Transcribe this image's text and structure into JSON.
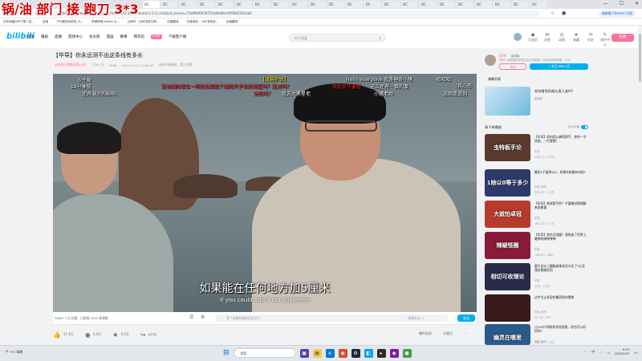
{
  "overlay": {
    "title": "锅/油 部门 接 跑刀 3*3"
  },
  "browser": {
    "tabs": [
      "DC",
      "DC",
      "DC",
      "DC",
      "DC",
      "DC",
      "DC",
      "DC",
      "DC",
      "DC",
      "DC",
      "DC",
      "DC",
      "DC",
      "DC",
      "DC",
      "DC",
      "DC",
      "DC",
      "DC",
      "DC",
      "DC"
    ],
    "address": "bilibili.com/video/BV1...?spm_id_from=333.1007.tianma.1-2-2.click&vd_source=74d09d6678725e9ba8ec9058b5202eb4",
    "chrome_button": "有新版 Chrome 可用",
    "bookmarks": [
      "文件网盘APP下载 | 百...",
      "百度",
      "下行服务系统查_代...",
      "哔哩哔哩_bilibili 大...",
      "比特币 · 比特币官方网...",
      "百度翻译",
      "抖音网站 - 小红书网站...",
      "百度翻译"
    ]
  },
  "site": {
    "logo": "bilibili",
    "nav": [
      "首页",
      "番剧",
      "直播",
      "游戏中心",
      "会员购",
      "漫画",
      "赛事",
      "拜年纪",
      "LIVE",
      "下载客户端"
    ],
    "search_placeholder": "你不知道",
    "header_icons": [
      {
        "glyph": "◆",
        "label": "大会员"
      },
      {
        "glyph": "✉",
        "label": "消息"
      },
      {
        "glyph": "◎",
        "label": "动态"
      },
      {
        "glyph": "★",
        "label": "收藏"
      },
      {
        "glyph": "⟲",
        "label": "历史"
      },
      {
        "glyph": "✎",
        "label": "创作中心"
      }
    ],
    "upload": "投稿"
  },
  "video": {
    "title": "【毕导】你永远测不出这条线有多长",
    "meta": {
      "tag": "全站排行榜最高第10名",
      "views": "136.1万",
      "danmaku": "5489",
      "date": "2024-02-11 11:00:00",
      "copyright": "未经作者授权，禁止转载"
    },
    "danmaku": [
      {
        "text": "沙子呢",
        "color": "#ffffff"
      },
      {
        "text": "18分钟前",
        "color": "#ffffff"
      },
      {
        "text": "还有潮汐的影响",
        "color": "#ffffff"
      },
      {
        "text": "没有国际单位一样的东西就个国际尺子长的测定吗？这对吗？",
        "color": "#ff2a2a"
      },
      {
        "text": "分形吗？",
        "color": "#ff2a2a"
      },
      {
        "text": "【弹幕护体】",
        "color": "#ffe600"
      },
      {
        "text": "我去大黑星老",
        "color": "#ffffff"
      },
      {
        "text": "我就是不要看",
        "color": "#ff2a2a"
      },
      {
        "text": "Hello everyone 我是神奇小猪",
        "color": "#ffffff"
      },
      {
        "text": "这么还有一数的事",
        "color": "#ffffff"
      },
      {
        "text": "小猪老师",
        "color": "#ffffff"
      },
      {
        "text": "哈哈哈",
        "color": "#ffffff"
      },
      {
        "text": "（我心态",
        "color": "#ffffff"
      },
      {
        "text": "这倒是提到",
        "color": "#ffffff"
      }
    ],
    "subtitle_cn": "如果能在任何地方加5厘米",
    "subtitle_en": "If you could add 5 cm anywhere",
    "danmaku_bar": {
      "count": "3088+人正在看，已装填 5000 条弹幕",
      "placeholder": "发个友善的弹幕见证当下",
      "send": "发送",
      "etiquette": "弹幕礼仪 >"
    },
    "actions": [
      {
        "glyph": "👍",
        "value": "11.6万"
      },
      {
        "glyph": "◉",
        "value": "5.4万"
      },
      {
        "glyph": "★",
        "value": "3.0万"
      },
      {
        "glyph": "↪",
        "value": "4779"
      }
    ],
    "actions_right": [
      "稿件投诉",
      "记笔记",
      "⋯"
    ]
  },
  "sidebar": {
    "up_name": "毕导",
    "up_badge": "发消息",
    "up_desc": "科研一线颓废科学博主的日常更新，比起科研更有趣！TUP...",
    "charge": "充电",
    "follow": "+ 关注 986.5万",
    "danmaku_list": "弹幕列表",
    "ad": {
      "title": "如何看到风格从真人变AI?",
      "sub": "剧版拍"
    },
    "next_label": "接下来播放",
    "autoplay": "自动连播",
    "recs": [
      {
        "thumb": "虫特板手论",
        "title": "【毕导】如何用心搞得两手，你你一字语录，一打就就!",
        "up": "毕导",
        "stats": "336.4万 · 2.3万",
        "bg": "#5a3a2c"
      },
      {
        "thumb": "1除以0等于多少",
        "title": "最初1千旋除以0，如果风神要有何说?",
        "up": "毕导_科学",
        "stats": "297.9万 · 1.2万",
        "bg": "#2c3a6a"
      },
      {
        "thumb": "大就怕卓冠",
        "title": "【毕导】地球是平的？不要硬讲我理解来说能懂",
        "up": "毕导",
        "stats": "102.1万 · 1.7万",
        "bg": "#b83a2a"
      },
      {
        "thumb": "辣椒怪圈",
        "title": "【毕导】改东北怪圈？我找来了世界上最弹的弹弹弹弹",
        "up": "毕导",
        "stats": "786.6万 · 6681",
        "bg": "#8a1a3a"
      },
      {
        "thumb": "相切可收理论",
        "title": "要片设计上翻脑部来说怎么吃了?以及我好能够应用",
        "up": "毕导",
        "stats": "45万 · 8.4万",
        "bg": "#2a2a4a"
      },
      {
        "thumb": "",
        "title": "边今为止发现的最奇怪的素数",
        "up": "毕导_科学",
        "stats": "44.7万 · 293",
        "bg": "#3a1a1a"
      },
      {
        "thumb": "幽灵在哪里",
        "title": "让100只鸡和你发现惊喜，你也可以好好的?",
        "up": "毕导_科学",
        "stats": "980.2万 · 1.4万",
        "bg": "#2a5a8a"
      }
    ]
  },
  "taskbar": {
    "weather_temp": "5°C",
    "weather_desc": "晴朗",
    "search_placeholder": "搜索",
    "time": "6:13",
    "date": "2024/2/15",
    "lang": "中"
  }
}
